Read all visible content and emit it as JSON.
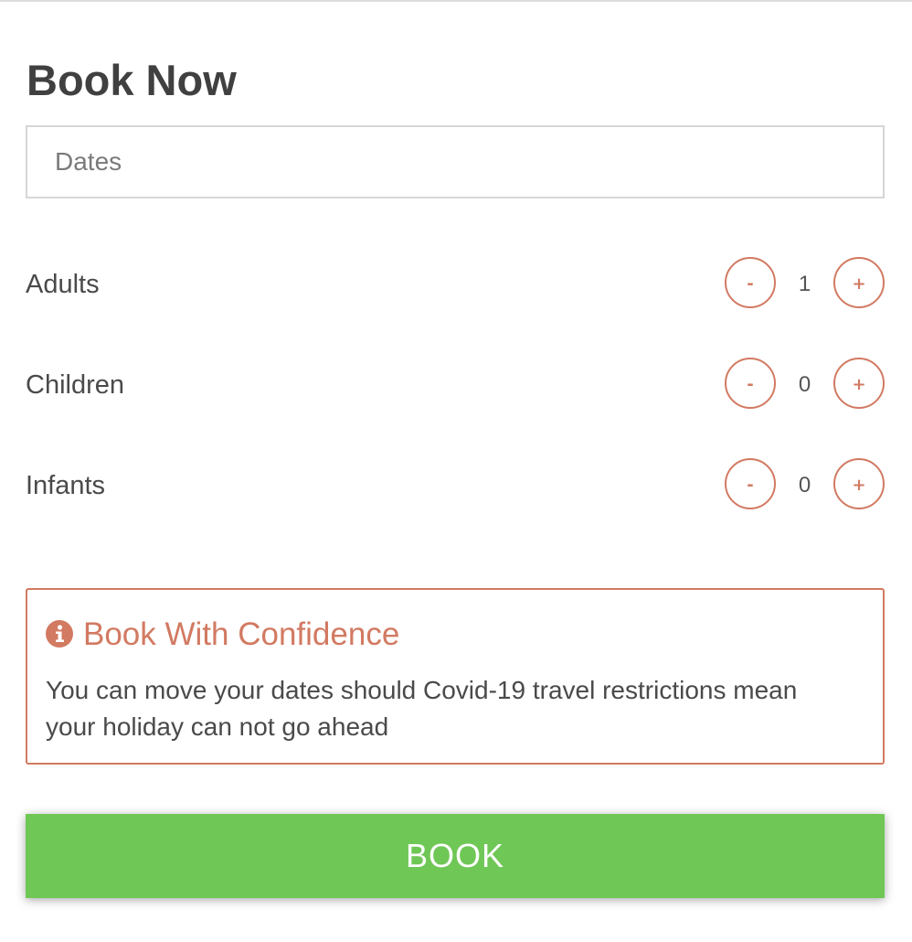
{
  "colors": {
    "accent": "#d27a62",
    "book_button": "#6fc756",
    "text": "#444444"
  },
  "header": {
    "title": "Book Now"
  },
  "dates": {
    "placeholder": "Dates",
    "value": ""
  },
  "guests": [
    {
      "label": "Adults",
      "value": "1",
      "minus": "-",
      "plus": "+"
    },
    {
      "label": "Children",
      "value": "0",
      "minus": "-",
      "plus": "+"
    },
    {
      "label": "Infants",
      "value": "0",
      "minus": "-",
      "plus": "+"
    }
  ],
  "notice": {
    "icon": "info-circle-icon",
    "title": "Book With Confidence",
    "text": "You can move your dates should Covid-19 travel restrictions mean your holiday can not go ahead"
  },
  "book_button": {
    "label": "BOOK"
  }
}
